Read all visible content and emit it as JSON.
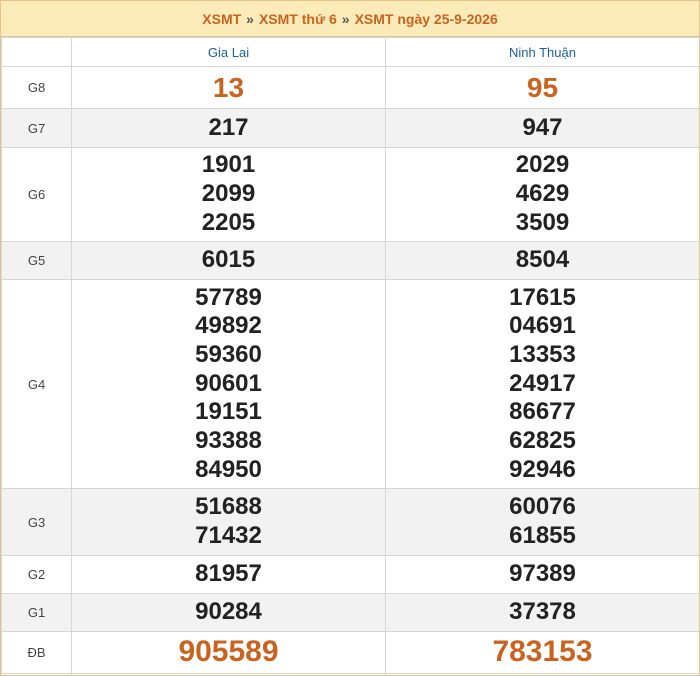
{
  "breadcrumb": {
    "part1": "XSMT",
    "part2": "XSMT thứ 6",
    "part3": "XSMT ngày 25-9-2026",
    "separator": "»"
  },
  "provinces": [
    "Gia Lai",
    "Ninh Thuận"
  ],
  "prizes": [
    {
      "label": "G8",
      "col1": [
        "13"
      ],
      "col2": [
        "95"
      ]
    },
    {
      "label": "G7",
      "col1": [
        "217"
      ],
      "col2": [
        "947"
      ]
    },
    {
      "label": "G6",
      "col1": [
        "1901",
        "2099",
        "2205"
      ],
      "col2": [
        "2029",
        "4629",
        "3509"
      ]
    },
    {
      "label": "G5",
      "col1": [
        "6015"
      ],
      "col2": [
        "8504"
      ]
    },
    {
      "label": "G4",
      "col1": [
        "57789",
        "49892",
        "59360",
        "90601",
        "19151",
        "93388",
        "84950"
      ],
      "col2": [
        "17615",
        "04691",
        "13353",
        "24917",
        "86677",
        "62825",
        "92946"
      ]
    },
    {
      "label": "G3",
      "col1": [
        "51688",
        "71432"
      ],
      "col2": [
        "60076",
        "61855"
      ]
    },
    {
      "label": "G2",
      "col1": [
        "81957"
      ],
      "col2": [
        "97389"
      ]
    },
    {
      "label": "G1",
      "col1": [
        "90284"
      ],
      "col2": [
        "37378"
      ]
    },
    {
      "label": "ĐB",
      "col1": [
        "905589"
      ],
      "col2": [
        "783153"
      ]
    }
  ],
  "colors": {
    "accent": "#c8641f",
    "header_bg": "#fbebb8",
    "province": "#1f5f9a",
    "alt_row": "#f2f2f2"
  }
}
